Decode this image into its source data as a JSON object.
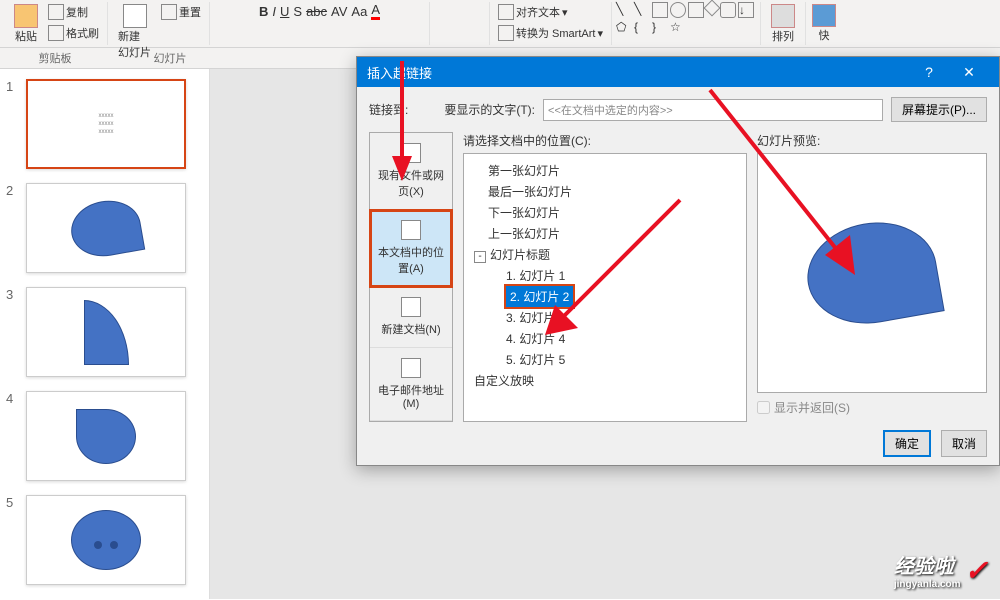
{
  "ribbon": {
    "paste": "粘贴",
    "copy": "复制",
    "format_painter": "格式刷",
    "new_slide": "新建\n幻灯片",
    "reset": "重置",
    "section_clipboard": "剪贴板",
    "section_slides": "幻灯片",
    "align_text": "对齐文本",
    "convert_smartart": "转换为 SmartArt",
    "arrange": "排列",
    "quick": "快"
  },
  "slides": {
    "s1": "1",
    "s2": "2",
    "s3": "3",
    "s4": "4",
    "s5": "5",
    "s1_lines": "xxxxx\nxxxxx\nxxxxx"
  },
  "dialog": {
    "title": "插入超链接",
    "help": "?",
    "close": "✕",
    "link_to": "链接到:",
    "display_text_label": "要显示的文字(T):",
    "display_text_value": "<<在文档中选定的内容>>",
    "screentip": "屏幕提示(P)...",
    "tab_existing": "现有文件或网页(X)",
    "tab_place": "本文档中的位置(A)",
    "tab_newdoc": "新建文档(N)",
    "tab_email": "电子邮件地址(M)",
    "pos_label": "请选择文档中的位置(C):",
    "tree": {
      "first": "第一张幻灯片",
      "last": "最后一张幻灯片",
      "next": "下一张幻灯片",
      "prev": "上一张幻灯片",
      "titles": "幻灯片标题",
      "s1": "1. 幻灯片 1",
      "s2": "2. 幻灯片 2",
      "s3": "3. 幻灯片 3",
      "s4": "4. 幻灯片 4",
      "s5": "5. 幻灯片 5",
      "custom": "自定义放映"
    },
    "preview_label": "幻灯片预览:",
    "show_return": "显示并返回(S)",
    "ok": "确定",
    "cancel": "取消"
  },
  "watermark": {
    "main": "经验啦",
    "sub": "jingyanla.com",
    "check": "✓"
  }
}
